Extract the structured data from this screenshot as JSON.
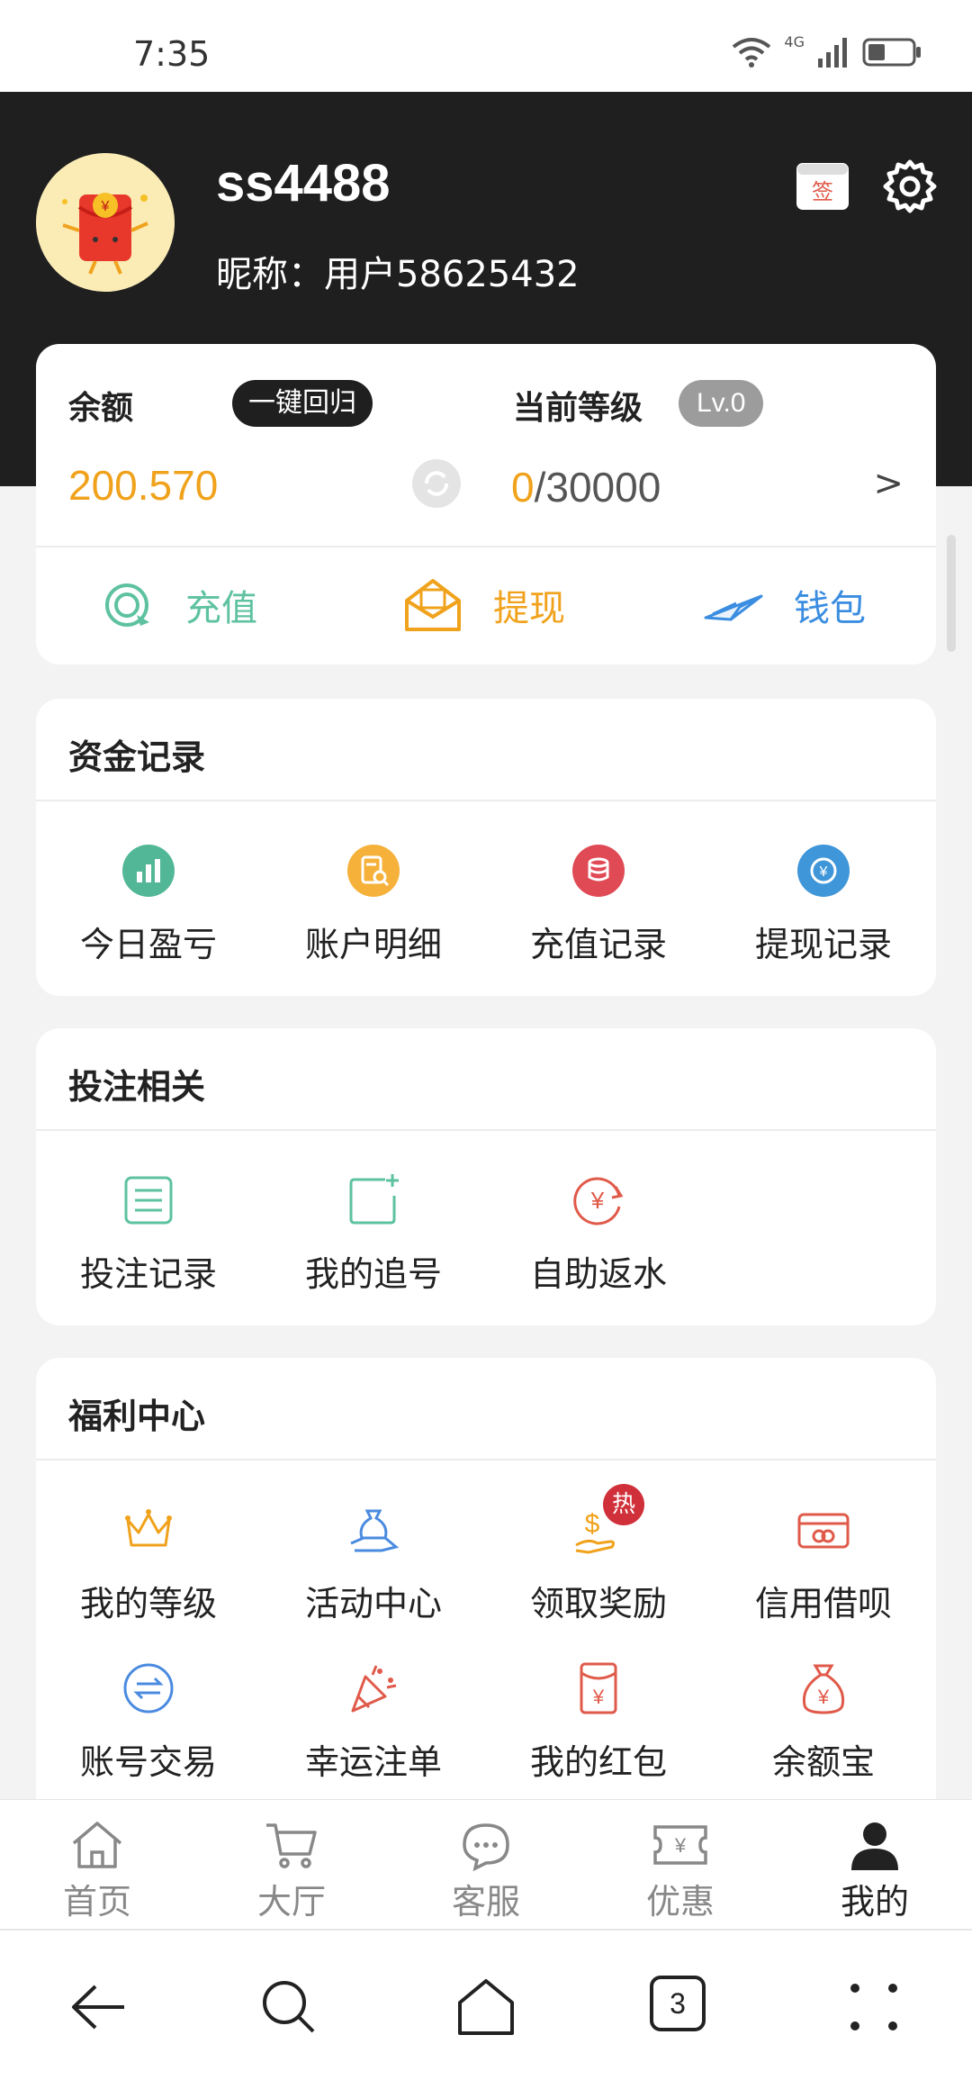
{
  "status_bar": {
    "time": "7:35",
    "network": "4G"
  },
  "profile": {
    "username": "ss4488",
    "nickname": "昵称：用户58625432"
  },
  "balance_card": {
    "balance_label": "余额",
    "reclaim_label": "一键回归",
    "balance_value": "200.570",
    "level_label": "当前等级",
    "level_badge": "Lv.0",
    "level_current": "0",
    "level_total": "/30000",
    "arrow": ">",
    "actions": [
      {
        "label": "充值",
        "icon": "recharge-icon",
        "color": "#5ec2a0"
      },
      {
        "label": "提现",
        "icon": "envelope-icon",
        "color": "#f0a21c"
      },
      {
        "label": "钱包",
        "icon": "paper-plane-icon",
        "color": "#3a8de0"
      }
    ]
  },
  "sections": [
    {
      "title": "资金记录",
      "items": [
        {
          "label": "今日盈亏",
          "icon": "bar-chart-icon"
        },
        {
          "label": "账户明细",
          "icon": "document-search-icon"
        },
        {
          "label": "充值记录",
          "icon": "coins-icon"
        },
        {
          "label": "提现记录",
          "icon": "yuan-refresh-icon"
        }
      ]
    },
    {
      "title": "投注相关",
      "items": [
        {
          "label": "投注记录",
          "icon": "list-icon"
        },
        {
          "label": "我的追号",
          "icon": "add-note-icon"
        },
        {
          "label": "自助返水",
          "icon": "yuan-cycle-icon"
        }
      ]
    },
    {
      "title": "福利中心",
      "items": [
        {
          "label": "我的等级",
          "icon": "crown-icon"
        },
        {
          "label": "活动中心",
          "icon": "gift-bag-icon"
        },
        {
          "label": "领取奖励",
          "icon": "hand-coin-icon",
          "badge": "热"
        },
        {
          "label": "信用借呗",
          "icon": "credit-card-icon"
        },
        {
          "label": "账号交易",
          "icon": "exchange-icon"
        },
        {
          "label": "幸运注单",
          "icon": "party-popper-icon"
        },
        {
          "label": "我的红包",
          "icon": "red-envelope-icon"
        },
        {
          "label": "余额宝",
          "icon": "money-bag-icon"
        }
      ]
    }
  ],
  "tabbar": [
    {
      "label": "首页",
      "icon": "home-icon"
    },
    {
      "label": "大厅",
      "icon": "cart-icon"
    },
    {
      "label": "客服",
      "icon": "chat-icon"
    },
    {
      "label": "优惠",
      "icon": "ticket-icon"
    },
    {
      "label": "我的",
      "icon": "user-icon",
      "active": true
    }
  ],
  "system_nav": {
    "tabs_count": "3"
  },
  "colors": {
    "header_bg": "#1f1f1f",
    "accent_orange": "#f0a21c",
    "green": "#5ec2a0",
    "blue": "#3a8de0",
    "red": "#e05a4a"
  }
}
